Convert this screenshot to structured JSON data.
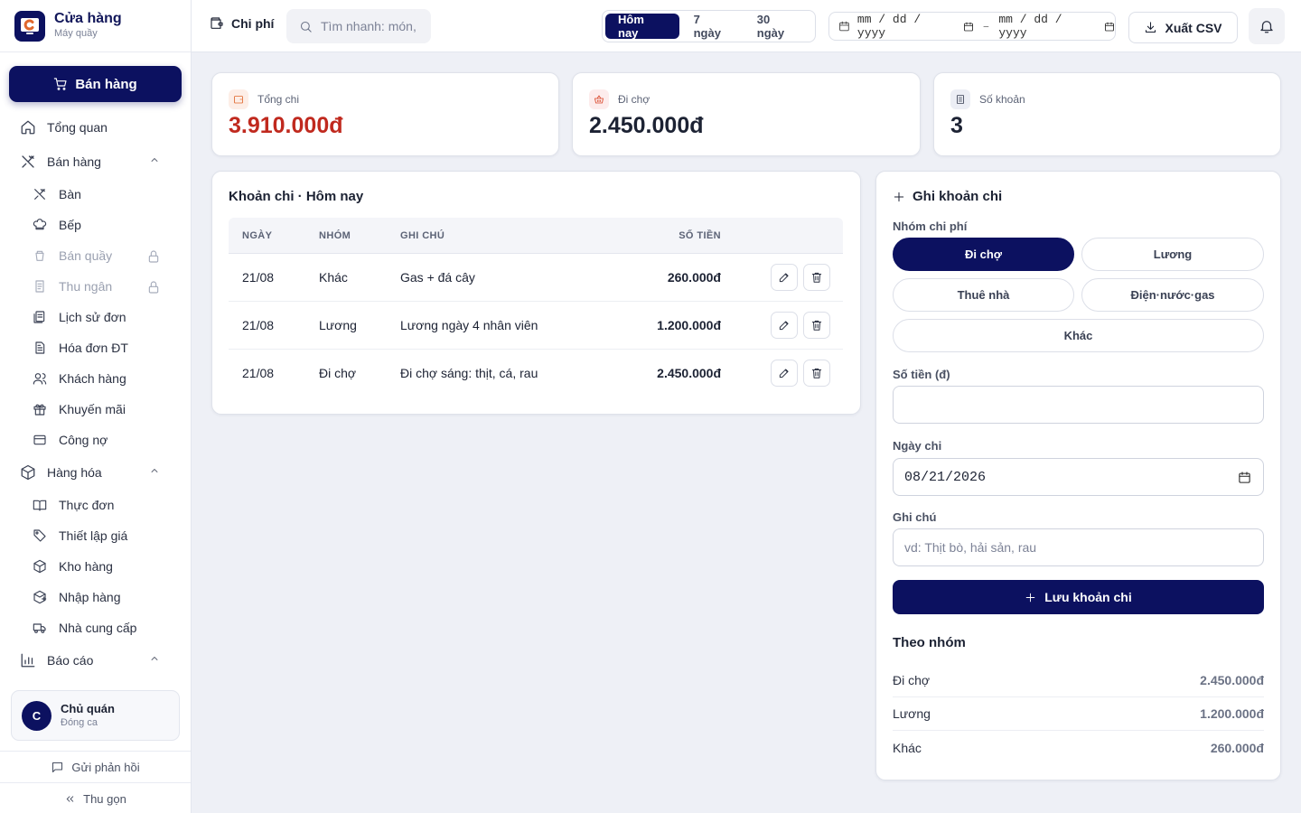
{
  "brand": {
    "title": "Cửa hàng",
    "subtitle": "Máy quầy"
  },
  "sidebar": {
    "sell_button": "Bán hàng",
    "items": [
      {
        "label": "Tổng quan",
        "icon": "home-icon"
      },
      {
        "label": "Bán hàng",
        "icon": "utensils-icon",
        "expanded": true
      },
      {
        "label": "Bàn",
        "icon": "utensils-icon"
      },
      {
        "label": "Bếp",
        "icon": "chef-hat-icon"
      },
      {
        "label": "Bán quầy",
        "icon": "cup-icon",
        "locked": true
      },
      {
        "label": "Thu ngân",
        "icon": "receipt-icon",
        "locked": true
      },
      {
        "label": "Lịch sử đơn",
        "icon": "history-icon"
      },
      {
        "label": "Hóa đơn ĐT",
        "icon": "invoice-icon"
      },
      {
        "label": "Khách hàng",
        "icon": "users-icon"
      },
      {
        "label": "Khuyến mãi",
        "icon": "gift-icon"
      },
      {
        "label": "Công nợ",
        "icon": "credit-card-icon"
      },
      {
        "label": "Hàng hóa",
        "icon": "box-icon",
        "expanded": true
      },
      {
        "label": "Thực đơn",
        "icon": "book-icon"
      },
      {
        "label": "Thiết lập giá",
        "icon": "tag-icon"
      },
      {
        "label": "Kho hàng",
        "icon": "box-icon"
      },
      {
        "label": "Nhập hàng",
        "icon": "package-plus-icon"
      },
      {
        "label": "Nhà cung cấp",
        "icon": "truck-icon"
      },
      {
        "label": "Báo cáo",
        "icon": "bar-chart-icon",
        "expanded": true
      }
    ],
    "user": {
      "initial": "C",
      "name": "Chủ quán",
      "role": "Đóng ca"
    },
    "feedback": "Gửi phản hồi",
    "collapse": "Thu gọn"
  },
  "header": {
    "title": "Chi phí",
    "search_placeholder": "Tìm nhanh: món, bàn, hóa đơn",
    "ranges": [
      "Hôm nay",
      "7 ngày",
      "30 ngày"
    ],
    "active_range": "Hôm nay",
    "date_from": "mm / dd / yyyy",
    "date_sep": "–",
    "date_to": "mm / dd / yyyy",
    "export": "Xuất CSV"
  },
  "stats": [
    {
      "label": "Tổng chi",
      "value": "3.910.000đ",
      "color": "#c0291e",
      "icon": "wallet-icon",
      "icon_bg": "#fdeee7",
      "icon_color": "#e0682e"
    },
    {
      "label": "Đi chợ",
      "value": "2.450.000đ",
      "color": "#1c2233",
      "icon": "basket-icon",
      "icon_bg": "#fdecec",
      "icon_color": "#d9482b"
    },
    {
      "label": "Số khoản",
      "value": "3",
      "color": "#1c2233",
      "icon": "document-icon",
      "icon_bg": "#eceef5",
      "icon_color": "#3a4154"
    }
  ],
  "table": {
    "title": "Khoản chi · Hôm nay",
    "columns": [
      "NGÀY",
      "NHÓM",
      "GHI CHÚ",
      "SỐ TIỀN"
    ],
    "rows": [
      {
        "date": "21/08",
        "group": "Khác",
        "note": "Gas + đá cây",
        "amount": "260.000đ"
      },
      {
        "date": "21/08",
        "group": "Lương",
        "note": "Lương ngày 4 nhân viên",
        "amount": "1.200.000đ"
      },
      {
        "date": "21/08",
        "group": "Đi chợ",
        "note": "Đi chợ sáng: thịt, cá, rau",
        "amount": "2.450.000đ"
      }
    ]
  },
  "form": {
    "title": "Ghi khoản chi",
    "category_label": "Nhóm chi phí",
    "categories": [
      "Đi chợ",
      "Lương",
      "Thuê nhà",
      "Điện·nước·gas",
      "Khác"
    ],
    "active_category": "Đi chợ",
    "amount_label": "Số tiền (đ)",
    "amount_value": "",
    "date_label": "Ngày chi",
    "date_value": "08/21/2026",
    "note_label": "Ghi chú",
    "note_placeholder": "vd: Thịt bò, hải sản, rau",
    "save_button": "Lưu khoản chi",
    "by_group_title": "Theo nhóm",
    "by_group": [
      {
        "name": "Đi chợ",
        "value": "2.450.000đ"
      },
      {
        "name": "Lương",
        "value": "1.200.000đ"
      },
      {
        "name": "Khác",
        "value": "260.000đ"
      }
    ]
  }
}
